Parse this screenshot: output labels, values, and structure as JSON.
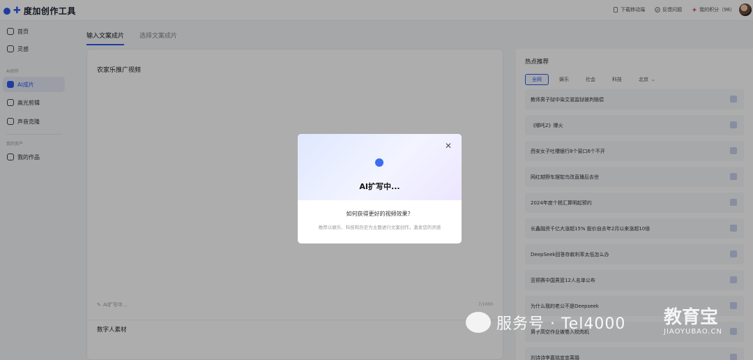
{
  "app": {
    "logo_text": "度加创作工具"
  },
  "topbar": {
    "actions": [
      {
        "label": "下载移动端",
        "icon": "mobile-icon"
      },
      {
        "label": "反馈问题",
        "icon": "feedback-icon"
      },
      {
        "label": "我的积分（98）",
        "icon": "points-icon"
      }
    ]
  },
  "sidebar": {
    "items": [
      {
        "label": "首页",
        "icon": "home-icon"
      },
      {
        "label": "灵感",
        "icon": "inspiration-icon"
      }
    ],
    "group_create": "AI创作",
    "create_items": [
      {
        "label": "AI成片",
        "icon": "ai-video-icon"
      },
      {
        "label": "高光剪辑",
        "icon": "highlight-clip-icon"
      },
      {
        "label": "声音克隆",
        "icon": "voice-clone-icon"
      }
    ],
    "group_assets": "我的资产",
    "asset_items": [
      {
        "label": "我的作品",
        "icon": "my-works-icon"
      }
    ]
  },
  "tabs": [
    {
      "label": "输入文案成片"
    },
    {
      "label": "选择文案成片"
    }
  ],
  "editor": {
    "title": "农家乐推广视频",
    "ai_expand": "AI扩写中...",
    "char_count": "7/1000",
    "digital_human": "数字人素材"
  },
  "hot": {
    "title": "热点推荐",
    "filters": [
      "全网",
      "娱乐",
      "社会",
      "科技",
      "北京"
    ],
    "items": [
      "教师男子狱中染艾滋监狱被判赔偿",
      "《哪吒2》爆火",
      "西安女子吐槽银行8个窗口6个不开",
      "网红越野车摆鸵鸟改直播后去世",
      "2024年度个税汇算明起预约",
      "长鑫融资千亿大涨超15% 股价自去年2月以来涨超10倍",
      "DeepSeek回答存款利率太低怎么办",
      "亚预赛中国男篮12人名单公布",
      "为什么我的老公不是Deepseek",
      "男子高空作业被卷入绞肉机",
      "刘诗诗李嘉铭宣宣离婚"
    ]
  },
  "modal": {
    "title": "AI扩写中...",
    "question": "如何获得更好的视频效果？",
    "tip": "推荐以娱乐、科技和历史为主题进行文案创作，激发您的灵感",
    "close_icon": "close-icon"
  },
  "watermark": {
    "text": "服务号 · Tel4000",
    "brand": "教育宝",
    "domain": "JIAOYUBAO.CN"
  },
  "colors": {
    "accent": "#2f5bea",
    "overlay": "rgba(0,0,0,0.32)"
  }
}
